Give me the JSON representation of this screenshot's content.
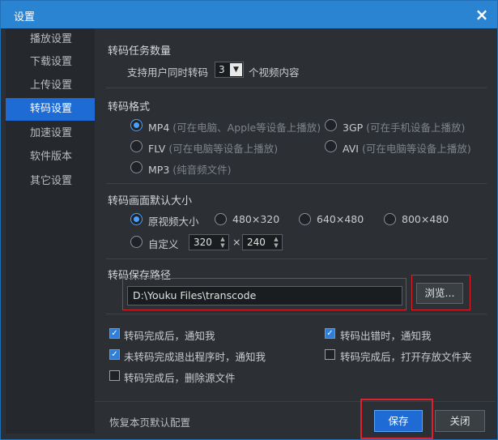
{
  "window": {
    "title": "设置",
    "close_icon": "×"
  },
  "sidebar": {
    "items": [
      {
        "label": "播放设置"
      },
      {
        "label": "下载设置"
      },
      {
        "label": "上传设置"
      },
      {
        "label": "转码设置",
        "active": true
      },
      {
        "label": "加速设置"
      },
      {
        "label": "软件版本"
      },
      {
        "label": "其它设置"
      }
    ]
  },
  "task_count": {
    "title": "转码任务数量",
    "prefix": "支持用户同时转码",
    "value": "3",
    "suffix": "个视频内容"
  },
  "format": {
    "title": "转码格式",
    "options": [
      {
        "label": "MP4",
        "hint": "(可在电脑、Apple等设备上播放)",
        "selected": true
      },
      {
        "label": "3GP",
        "hint": "(可在手机设备上播放)",
        "selected": false
      },
      {
        "label": "FLV",
        "hint": "(可在电脑等设备上播放)",
        "selected": false
      },
      {
        "label": "AVI",
        "hint": "(可在电脑等设备上播放)",
        "selected": false
      },
      {
        "label": "MP3",
        "hint": "(纯音频文件)",
        "selected": false
      }
    ]
  },
  "size": {
    "title": "转码画面默认大小",
    "options": [
      {
        "label": "原视频大小",
        "selected": true
      },
      {
        "label": "480×320",
        "selected": false
      },
      {
        "label": "640×480",
        "selected": false
      },
      {
        "label": "800×480",
        "selected": false
      },
      {
        "label": "自定义",
        "selected": false
      }
    ],
    "custom_width": "320",
    "times": "×",
    "custom_height": "240"
  },
  "save_path": {
    "title": "转码保存路径",
    "value": "D:\\Youku Files\\transcode",
    "browse_label": "浏览..."
  },
  "notify": {
    "options": [
      {
        "label": "转码完成后，通知我",
        "checked": true
      },
      {
        "label": "转码出错时，通知我",
        "checked": true
      },
      {
        "label": "未转码完成退出程序时，通知我",
        "checked": true
      },
      {
        "label": "转码完成后，打开存放文件夹",
        "checked": false
      },
      {
        "label": "转码完成后，删除源文件",
        "checked": false
      }
    ]
  },
  "footer": {
    "restore_label": "恢复本页默认配置",
    "save_label": "保存",
    "close_label": "关闭"
  },
  "colors": {
    "accent": "#1f6bd6",
    "titlebar": "#2b84d2",
    "highlight": "#e0202a"
  }
}
